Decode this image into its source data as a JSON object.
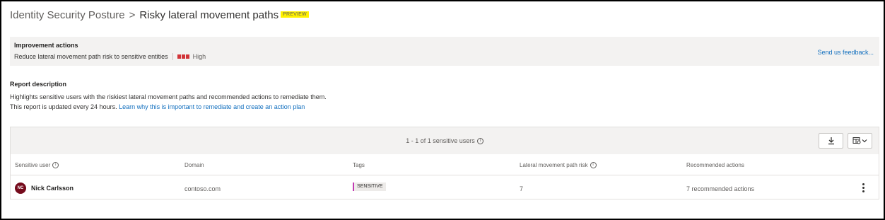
{
  "header": {
    "crumb": "Identity Security Posture",
    "separator": ">",
    "title": "Risky lateral movement paths",
    "badge": "PREVIEW"
  },
  "improvement": {
    "heading": "Improvement actions",
    "action": "Reduce lateral movement path risk to sensitive entities",
    "risk_label": "High",
    "risk_color": "#d13438",
    "feedback": "Send us feedback..."
  },
  "report": {
    "heading": "Report description",
    "line1": "Highlights sensitive users with the riskiest lateral movement paths and recommended actions to remediate them.",
    "line2": "This report is updated every 24 hours.",
    "link": "Learn why this is important to remediate and create an action plan"
  },
  "table": {
    "count": "1 - 1 of 1 sensitive users",
    "icons": {
      "download": "download-icon",
      "columns": "column-settings-icon",
      "info": "info-icon",
      "more": "more-icon"
    },
    "columns": {
      "user": "Sensitive user",
      "domain": "Domain",
      "tags": "Tags",
      "risk": "Lateral movement path risk",
      "actions": "Recommended actions"
    },
    "rows": [
      {
        "initials": "NC",
        "name": "Nick Carlsson",
        "domain": "contoso.com",
        "tag": "SENSITIVE",
        "risk": "7",
        "actions": "7 recommended actions"
      }
    ]
  }
}
